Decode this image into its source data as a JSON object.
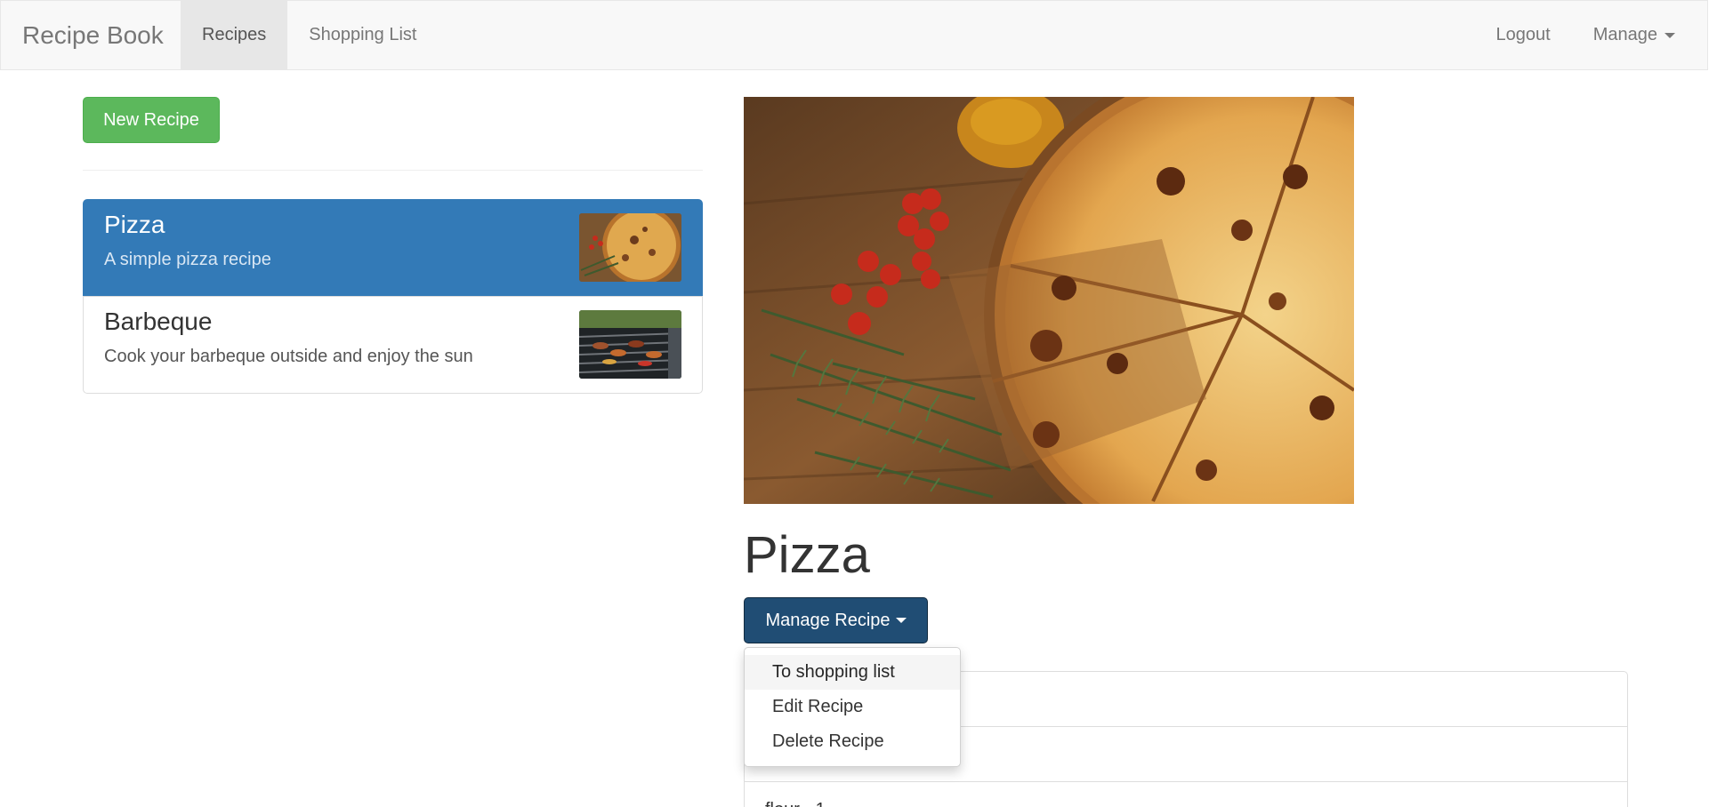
{
  "navbar": {
    "brand": "Recipe Book",
    "links": [
      "Recipes",
      "Shopping List"
    ],
    "logout": "Logout",
    "manage": "Manage"
  },
  "sidebar": {
    "new_recipe_label": "New Recipe",
    "recipes": [
      {
        "name": "Pizza",
        "description": "A simple pizza recipe",
        "active": true
      },
      {
        "name": "Barbeque",
        "description": "Cook your barbeque outside and enjoy the sun",
        "active": false
      }
    ]
  },
  "detail": {
    "title": "Pizza",
    "manage_button": "Manage Recipe",
    "dropdown": [
      "To shopping list",
      "Edit Recipe",
      "Delete Recipe"
    ],
    "ingredients": [
      "",
      "",
      "flour - 1"
    ]
  },
  "colors": {
    "success": "#5cb85c",
    "primary": "#337ab7",
    "primary_dark": "#204d74"
  }
}
